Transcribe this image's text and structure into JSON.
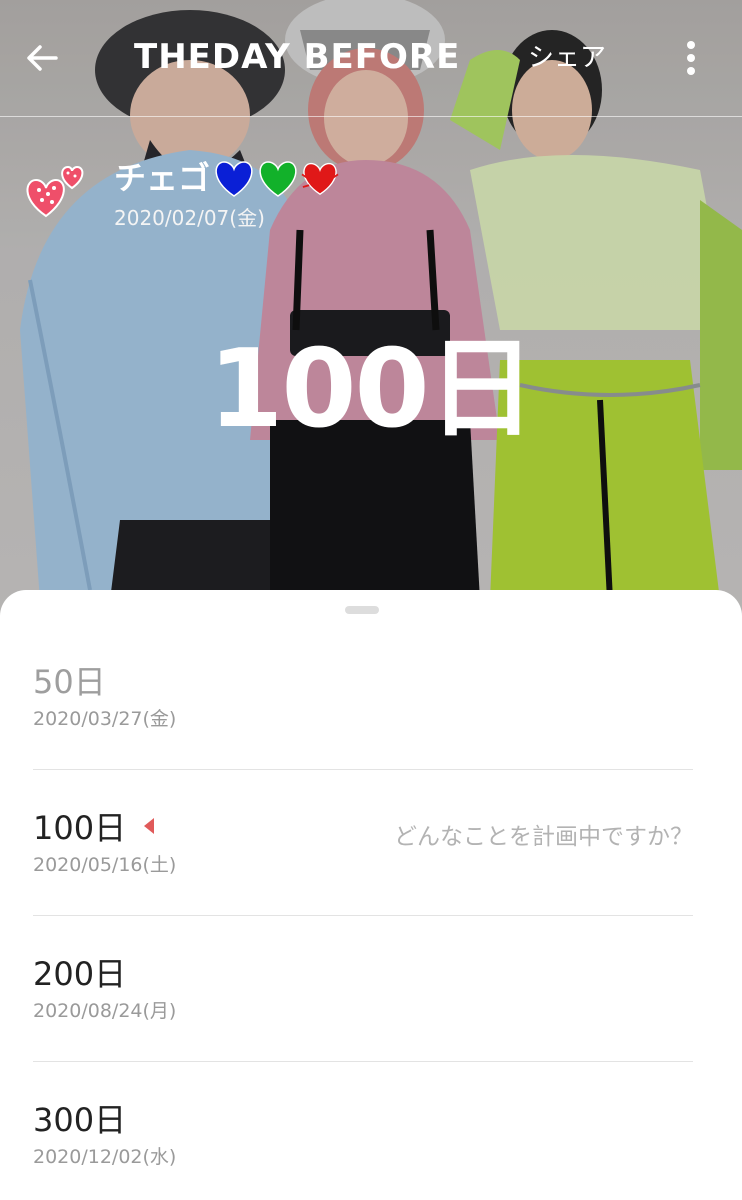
{
  "header": {
    "back_icon": "arrow-left-icon",
    "brand": "THEDAY BEFORE",
    "share_label": "シェア",
    "more_icon": "more-vertical-icon"
  },
  "event": {
    "icon": "sparkling-hearts-icon",
    "title": "チェゴ",
    "title_hearts": [
      "blue-heart",
      "green-heart",
      "red-heart"
    ],
    "date": "2020/02/07(金)",
    "count": "100日"
  },
  "milestones": [
    {
      "days": "50日",
      "date": "2020/03/27(金)",
      "state": "past"
    },
    {
      "days": "100日",
      "date": "2020/05/16(土)",
      "state": "current",
      "hint": "どんなことを計画中ですか？"
    },
    {
      "days": "200日",
      "date": "2020/08/24(月)",
      "state": "future"
    },
    {
      "days": "300日",
      "date": "2020/12/02(水)",
      "state": "future"
    }
  ],
  "colors": {
    "heart_blue": "#0a1fd6",
    "heart_green": "#12b12a",
    "heart_red": "#e01818",
    "today_marker": "#e05a5a"
  }
}
